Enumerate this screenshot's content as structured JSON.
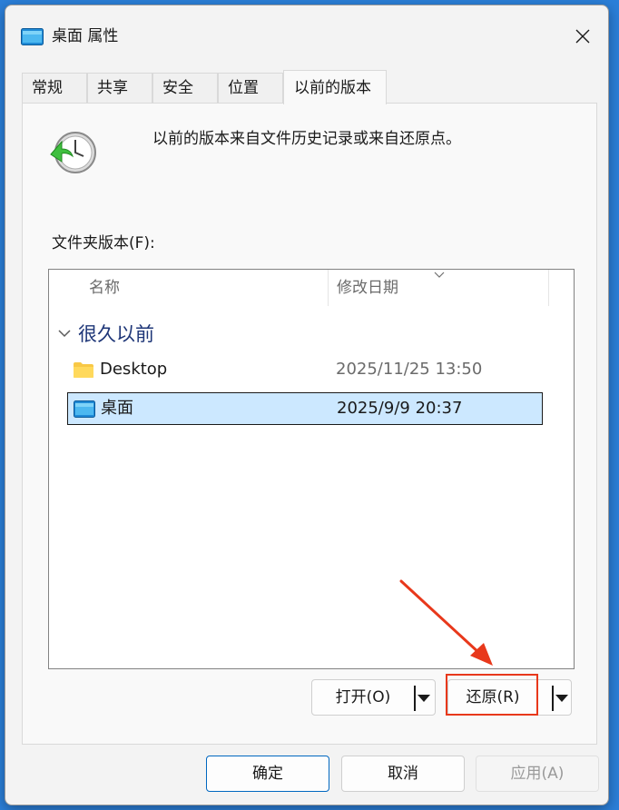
{
  "window": {
    "title": "桌面 属性",
    "close_icon": "close-icon"
  },
  "tabs": [
    {
      "label": "常规",
      "active": false
    },
    {
      "label": "共享",
      "active": false
    },
    {
      "label": "安全",
      "active": false
    },
    {
      "label": "位置",
      "active": false
    },
    {
      "label": "以前的版本",
      "active": true
    }
  ],
  "panel": {
    "description": "以前的版本来自文件历史记录或来自还原点。",
    "versions_label": "文件夹版本(F):",
    "columns": {
      "name": "名称",
      "date": "修改日期"
    },
    "group": {
      "label": "很久以前",
      "expanded": true
    },
    "rows": [
      {
        "name": "Desktop",
        "date": "2025/11/25 13:50",
        "icon": "folder-icon",
        "selected": false
      },
      {
        "name": "桌面",
        "date": "2025/9/9 20:37",
        "icon": "desktop-folder-icon",
        "selected": true
      }
    ],
    "open_button": "打开(O)",
    "restore_button": "还原(R)"
  },
  "footer": {
    "ok": "确定",
    "cancel": "取消",
    "apply": "应用(A)"
  },
  "colors": {
    "accent": "#0067c0",
    "selection": "#cce8ff",
    "annotation": "#e8381b",
    "group_text": "#1d3577"
  }
}
